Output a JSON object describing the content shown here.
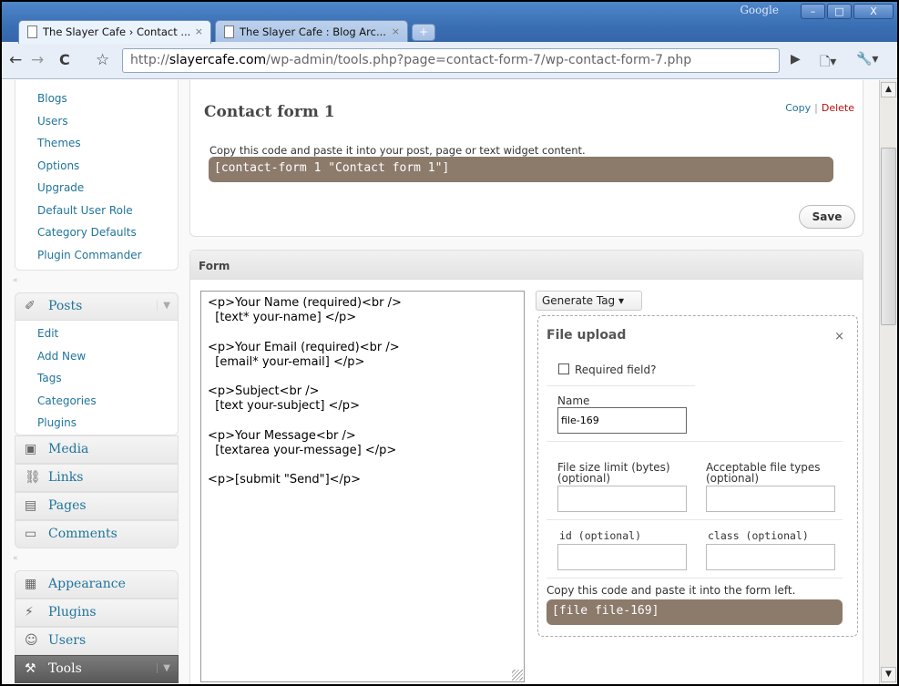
{
  "browser": {
    "brand": "Google",
    "window_buttons": [
      "–",
      "□",
      "X"
    ],
    "tabs": [
      {
        "title": "The Slayer Cafe › Contact ...",
        "close": "×"
      },
      {
        "title": "The Slayer Cafe : Blog Arc...",
        "close": "×"
      }
    ],
    "new_tab": "+",
    "url_prefix": "http://",
    "url_domain": "slayercafe.com",
    "url_path": "/wp-admin/tools.php?page=contact-form-7/wp-contact-form-7.php",
    "nav": {
      "back": "←",
      "forward": "→",
      "reload": "C",
      "star": "☆",
      "go": "▶",
      "page": "🗋▾",
      "wrench": "🔧▾"
    }
  },
  "sidebar": {
    "top_submenu": [
      "Blogs",
      "Users",
      "Themes",
      "Options",
      "Upgrade",
      "Default User Role",
      "Category Defaults",
      "Plugin Commander"
    ],
    "posts": {
      "label": "Posts",
      "icon": "pin-icon",
      "items": [
        "Edit",
        "Add New",
        "Tags",
        "Categories",
        "Plugins"
      ]
    },
    "menu1": [
      {
        "label": "Media",
        "icon": "media-icon"
      },
      {
        "label": "Links",
        "icon": "link-icon"
      },
      {
        "label": "Pages",
        "icon": "pages-icon"
      },
      {
        "label": "Comments",
        "icon": "comments-icon"
      }
    ],
    "menu2": [
      {
        "label": "Appearance",
        "icon": "appearance-icon"
      },
      {
        "label": "Plugins",
        "icon": "plugins-icon"
      },
      {
        "label": "Users",
        "icon": "users-icon"
      },
      {
        "label": "Tools",
        "icon": "tools-icon"
      }
    ]
  },
  "contact_form": {
    "title": "Contact form 1",
    "copy_label": "Copy",
    "separator": "|",
    "delete_label": "Delete",
    "instruction": "Copy this code and paste it into your post, page or text widget content.",
    "shortcode": "[contact-form 1 \"Contact form 1\"]",
    "save_label": "Save"
  },
  "form_panel": {
    "heading": "Form",
    "editor_lines": [
      "<p>Your Name (required)<br />",
      "  [text* your-name] </p>",
      "",
      "<p>Your Email (required)<br />",
      "  [email* your-email] </p>",
      "",
      "<p>Subject<br />",
      "  [text your-subject] </p>",
      "",
      "<p>Your Message<br />",
      "  [textarea your-message] </p>",
      "",
      "<p>[submit \"Send\"]</p>"
    ],
    "generate_tag": "Generate Tag ▾"
  },
  "tag_generator": {
    "title": "File upload",
    "close": "×",
    "required_label": "Required field?",
    "name_label": "Name",
    "name_value": "file-169",
    "size_label_1": "File size limit (bytes)",
    "size_label_2": "(optional)",
    "types_label_1": "Acceptable file types",
    "types_label_2": "(optional)",
    "id_label": "id (optional)",
    "class_label": "class (optional)",
    "instruction": "Copy this code and paste it into the form left.",
    "code": "[file file-169]"
  }
}
